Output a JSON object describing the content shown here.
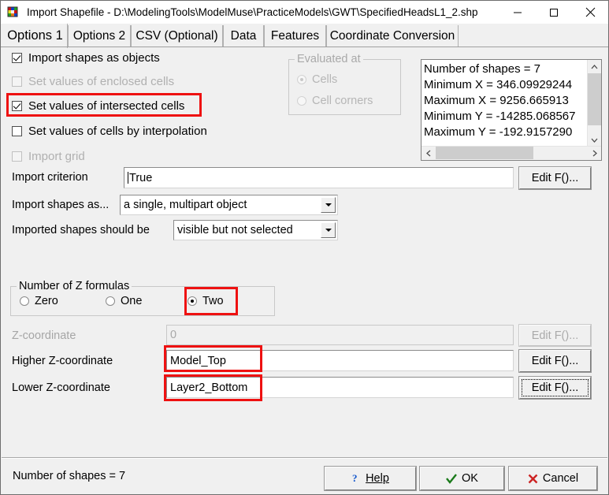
{
  "window": {
    "title": "Import Shapefile - D:\\ModelingTools\\ModelMuse\\PracticeModels\\GWT\\SpecifiedHeadsL1_2.shp",
    "icon": "modelmuse-cube-icon",
    "controls": {
      "minimize": "minimize-icon",
      "maximize": "maximize-icon",
      "close": "close-icon"
    }
  },
  "tabs": [
    {
      "label": "Options 1",
      "active": true
    },
    {
      "label": "Options 2",
      "active": false
    },
    {
      "label": "CSV (Optional)",
      "active": false
    },
    {
      "label": "Data",
      "active": false
    },
    {
      "label": "Features",
      "active": false
    },
    {
      "label": "Coordinate Conversion",
      "active": false
    }
  ],
  "options1": {
    "checkboxes": [
      {
        "label": "Import shapes as objects",
        "checked": true,
        "enabled": true,
        "highlighted": false
      },
      {
        "label": "Set values of enclosed cells",
        "checked": false,
        "enabled": false,
        "highlighted": false
      },
      {
        "label": "Set values of intersected cells",
        "checked": true,
        "enabled": true,
        "highlighted": true
      },
      {
        "label": "Set values of cells by interpolation",
        "checked": false,
        "enabled": true,
        "highlighted": false
      },
      {
        "label": "Import grid",
        "checked": false,
        "enabled": false,
        "highlighted": false
      }
    ],
    "evaluated_at": {
      "title": "Evaluated at",
      "enabled": false,
      "options": [
        {
          "label": "Cells",
          "selected": true
        },
        {
          "label": "Cell corners",
          "selected": false
        }
      ]
    },
    "info_list": {
      "lines": [
        "Number of shapes = 7",
        "Minimum X = 346.09929244",
        "Maximum X = 9256.665913",
        "Minimum Y = -14285.068567",
        "Maximum Y = -192.9157290"
      ]
    },
    "import_criterion": {
      "label": "Import criterion",
      "value": "True",
      "edit_button": "Edit F()..."
    },
    "import_shapes_as": {
      "label": "Import shapes as...",
      "value": "a single, multipart object"
    },
    "imported_shapes_should_be": {
      "label": "Imported shapes should be",
      "value": "visible but not selected"
    },
    "z_formulas": {
      "title": "Number of Z formulas",
      "options": [
        {
          "label": "Zero",
          "selected": false,
          "highlighted": false
        },
        {
          "label": "One",
          "selected": false,
          "highlighted": false
        },
        {
          "label": "Two",
          "selected": true,
          "highlighted": true
        }
      ]
    },
    "z_rows": [
      {
        "label": "Z-coordinate",
        "value": "0",
        "enabled": false,
        "highlighted": false,
        "button": "Edit F()...",
        "button_enabled": false,
        "button_focused": false
      },
      {
        "label": "Higher Z-coordinate",
        "value": "Model_Top",
        "enabled": true,
        "highlighted": true,
        "button": "Edit F()...",
        "button_enabled": true,
        "button_focused": false
      },
      {
        "label": "Lower Z-coordinate",
        "value": "Layer2_Bottom",
        "enabled": true,
        "highlighted": true,
        "button": "Edit F()...",
        "button_enabled": true,
        "button_focused": true
      }
    ]
  },
  "statusbar": {
    "text": "Number of shapes = 7",
    "buttons": {
      "help": "Help",
      "help_icon": "question-mark-icon",
      "ok": "OK",
      "ok_icon": "check-mark-icon",
      "cancel": "Cancel",
      "cancel_icon": "x-mark-icon"
    }
  },
  "colors": {
    "dialog_background": "#f0f0f0",
    "annotation_red": "#ee1111",
    "ok_green": "#1a7a1a",
    "cancel_red": "#cc2222",
    "help_blue": "#1155cc"
  }
}
